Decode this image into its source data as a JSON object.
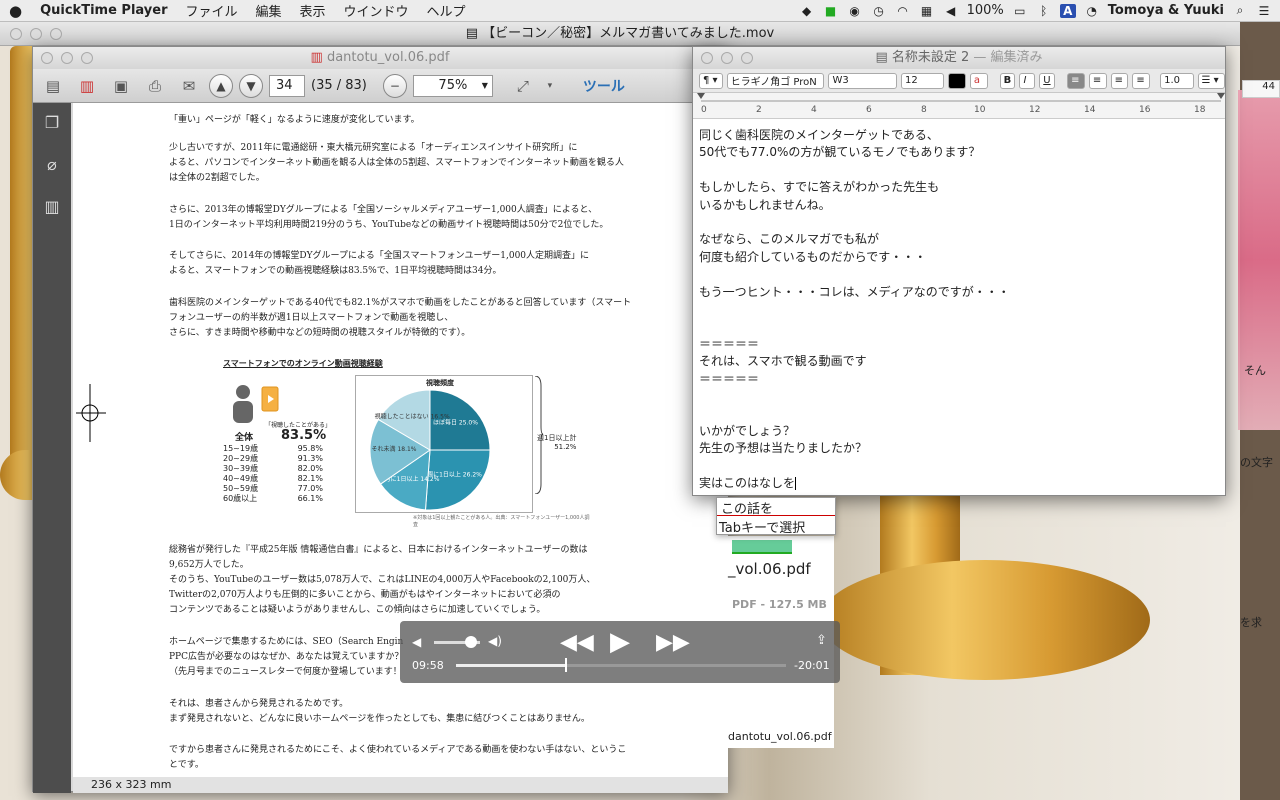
{
  "menubar": {
    "apple": "",
    "app": "QuickTime Player",
    "items": [
      "ファイル",
      "編集",
      "表示",
      "ウインドウ",
      "ヘルプ"
    ],
    "battery": "100%",
    "input_source": "A",
    "user": "Tomoya & Yuuki"
  },
  "movie": {
    "title": "【ビーコン／秘密】メルマガ書いてみました.mov",
    "edge_text": [
      "そん",
      "の文字",
      "を求"
    ],
    "right_ruler": "44"
  },
  "pdf": {
    "title": "dantotu_vol.06.pdf",
    "page_input": "34",
    "page_count": "(35 / 83)",
    "zoom": "75%",
    "tools_label": "ツール",
    "status": "236 x 323 mm",
    "paragraphs": [
      [
        "「重い」ページが「軽く」なるように速度が変化しています。"
      ],
      [
        "少し古いですが、2011年に電通総研・東大橋元研究室による「オーディエンスインサイト研究所」に",
        "よると、パソコンでインターネット動画を観る人は全体の5割超、スマートフォンでインターネット動画を観る人",
        "は全体の2割超でした。"
      ],
      [
        "さらに、2013年の博報堂DYグループによる「全国ソーシャルメディアユーザー1,000人調査」によると、",
        "1日のインターネット平均利用時間219分のうち、YouTubeなどの動画サイト視聴時間は50分で2位でした。"
      ],
      [
        "そしてさらに、2014年の博報堂DYグループによる「全国スマートフォンユーザー1,000人定期調査」に",
        "よると、スマートフォンでの動画視聴経験は83.5%で、1日平均視聴時間は34分。"
      ],
      [
        "歯科医院のメインターゲットである40代でも82.1%がスマホで動画をしたことがあると回答しています（スマート",
        "フォンユーザーの約半数が週1日以上スマートフォンで動画を視聴し、",
        "さらに、すきま時間や移動中などの短時間の視聴スタイルが特徴的です）。"
      ]
    ],
    "paragraphs_lower": [
      [
        "総務省が発行した『平成25年版 情報通信白書』によると、日本におけるインターネットユーザーの数は",
        "9,652万人でした。",
        "そのうち、YouTubeのユーザー数は5,078万人で、これはLINEの4,000万人やFacebookの2,100万人、",
        "Twitterの2,070万人よりも圧倒的に多いことから、動画がもはやインターネットにおいて必須の",
        "コンテンツであることは疑いようがありませんし、この傾向はさらに加速していくでしょう。"
      ],
      [
        "ホームページで集患するためには、SEO（Search Engin",
        "PPC広告が必要なのはなぜか、あなたは覚えていますか？",
        "（先月号までのニュースレターで何度か登場しています！"
      ],
      [
        "それは、患者さんから発見されるためです。",
        "まず発見されないと、どんなに良いホームページを作ったとしても、集患に結びつくことはありません。"
      ],
      [
        "ですから患者さんに発見されるためにこそ、よく使われているメディアである動画を使わない手はない、というこ",
        "とです。"
      ]
    ],
    "infographic": {
      "title": "スマートフォンでのオンライン動画視聴経験",
      "experienced_label": "「視聴したことがある」",
      "total_label": "全体",
      "total_value": "83.5%",
      "pie_title": "視聴頻度",
      "pie_right_label": "週1日以上計",
      "pie_right_value": "51.2%",
      "caption": "※対象は1回以上観たことがある人。出典：スマートフォンユーザー1,000人調査",
      "ages": [
        {
          "age": "15~19歳",
          "value": "95.8%"
        },
        {
          "age": "20~29歳",
          "value": "91.3%"
        },
        {
          "age": "30~39歳",
          "value": "82.0%"
        },
        {
          "age": "40~49歳",
          "value": "82.1%"
        },
        {
          "age": "50~59歳",
          "value": "77.0%"
        },
        {
          "age": "60歳以上",
          "value": "66.1%"
        }
      ],
      "slices": [
        {
          "label": "ほぼ毎日",
          "value": 25.0,
          "color": "#1f7a94",
          "text": "ほぼ毎日 25.0%"
        },
        {
          "label": "週に1日以上",
          "value": 26.2,
          "color": "#2b93b0",
          "text": "週に1日以上 26.2%"
        },
        {
          "label": "月に1日以上",
          "value": 14.2,
          "color": "#4aaac4",
          "text": "月に1日以上 14.2%"
        },
        {
          "label": "それ未満",
          "value": 18.1,
          "color": "#7cc0d3",
          "text": "それ未満 18.1%"
        },
        {
          "label": "視聴したことはない",
          "value": 16.5,
          "color": "#b3d9e4",
          "text": "視聴したことはない 16.5%"
        }
      ]
    }
  },
  "chart_data": {
    "type": "pie",
    "title": "視聴頻度",
    "labels": [
      "ほぼ毎日",
      "週に1日以上",
      "月に1日以上",
      "それ未満",
      "視聴したことはない"
    ],
    "values": [
      25.0,
      26.2,
      14.2,
      18.1,
      16.5
    ]
  },
  "hud": {
    "elapsed": "09:58",
    "remaining": "-20:01",
    "progress": 0.33,
    "volume": 0.8
  },
  "fileinfo": {
    "name": "_vol.06.pdf",
    "size": "PDF - 127.5 MB",
    "footer": "dantotu_vol.06.pdf"
  },
  "textedit": {
    "title": "名称未設定 2",
    "subtitle": " — 編集済み",
    "font": "ヒラギノ角ゴ ProN",
    "weight": "W3",
    "size": "12",
    "spacing": "1.0",
    "ruler_numbers": [
      "0",
      "2",
      "4",
      "6",
      "8",
      "10",
      "12",
      "14",
      "16",
      "18"
    ],
    "lines": [
      "同じく歯科医院のメインターゲットである、",
      "50代でも77.0%の方が観ているモノでもあります？",
      "",
      "もしかしたら、すでに答えがわかった先生も",
      "いるかもしれませんね。",
      "",
      "なぜなら、このメルマガでも私が",
      "何度も紹介しているものだからです・・・",
      "",
      "もう一つヒント・・・コレは、メディアなのですが・・・",
      "",
      "",
      "＝＝＝＝＝",
      "それは、スマホで観る動画です",
      "＝＝＝＝＝",
      "",
      "",
      "いかがでしょう？",
      "先生の予想は当たりましたか？",
      "",
      "実はこのはなしを"
    ],
    "autocomplete": [
      "この話を",
      "Tabキーで選択"
    ]
  }
}
